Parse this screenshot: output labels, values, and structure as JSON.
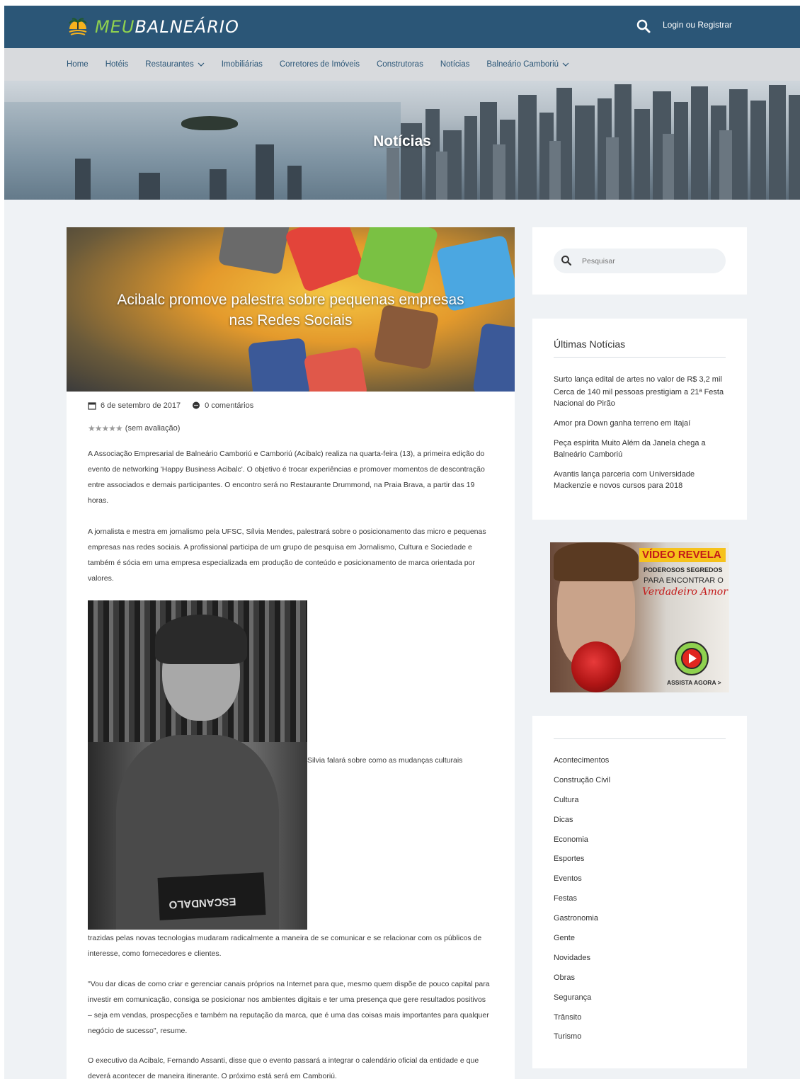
{
  "brand": {
    "logo_part1": "MEU",
    "logo_part2": "BALNEÁRIO"
  },
  "header": {
    "login_label": "Login ou Registrar"
  },
  "nav": {
    "items": [
      {
        "label": "Home",
        "dropdown": false
      },
      {
        "label": "Hotéis",
        "dropdown": false
      },
      {
        "label": "Restaurantes",
        "dropdown": true
      },
      {
        "label": "Imobiliárias",
        "dropdown": false
      },
      {
        "label": "Corretores de Imóveis",
        "dropdown": false
      },
      {
        "label": "Construtoras",
        "dropdown": false
      },
      {
        "label": "Notícias",
        "dropdown": false
      },
      {
        "label": "Balneário Camboriú",
        "dropdown": true
      }
    ]
  },
  "hero": {
    "title": "Notícias"
  },
  "article": {
    "title": "Acibalc promove palestra sobre pequenas empresas nas Redes Sociais",
    "date": "6 de setembro de 2017",
    "comments": "0 comentários",
    "stars": "★★★★★",
    "rating_text": "(sem avaliação)",
    "paragraphs": [
      "A Associação Empresarial de Balneário Camboriú e Camboriú (Acibalc) realiza na quarta-feira (13), a primeira edição do evento de networking 'Happy Business Acibalc'. O objetivo é trocar experiências e promover momentos de descontração entre associados e demais participantes. O encontro será no Restaurante Drummond, na Praia Brava, a partir das 19 horas.",
      "A jornalista e mestra em jornalismo pela UFSC, Sílvia Mendes, palestrará sobre o posicionamento das micro e pequenas empresas nas redes sociais. A profissional participa de um grupo de pesquisa em Jornalismo, Cultura e Sociedade e também é sócia em uma empresa especializada em produção de conteúdo e posicionamento de marca orientada por valores.",
      "trazidas pelas novas tecnologias mudaram radicalmente a maneira de se comunicar e se relacionar com os públicos de interesse, como fornecedores e clientes.",
      "\"Vou dar dicas de como criar e gerenciar canais próprios na Internet para que, mesmo quem dispõe de pouco capital para investir em comunicação, consiga se posicionar nos ambientes digitais e ter uma presença que gere resultados positivos – seja em vendas, prospecções e também na reputação da marca, que é uma das coisas mais importantes para qualquer negócio de sucesso\", resume.",
      "O executivo da Acibalc, Fernando Assanti, disse que o evento passará a integrar o calendário oficial da entidade e que deverá acontecer de maneira itinerante. O próximo está será em Camboriú."
    ],
    "photo_caption": "Silvia falará sobre como as mudanças culturais",
    "book_text": "ESCANDALO"
  },
  "sidebar": {
    "search_placeholder": "Pesquisar",
    "news_title": "Últimas Notícias",
    "news": [
      "Surto lança edital de artes no valor de R$ 3,2 mil",
      "Cerca de 140 mil pessoas prestigiam a 21ª Festa Nacional do Pirão",
      "Amor pra Down ganha terreno em Itajaí",
      "Peça espírita Muito Além da Janela chega a Balneário Camboriú",
      "Avantis lança parceria com Universidade Mackenzie e novos cursos para 2018"
    ],
    "ad": {
      "headline": "VÍDEO REVELA",
      "line2": "PODEROSOS SEGREDOS",
      "line3": "PARA ENCONTRAR O",
      "line4": "Verdadeiro Amor",
      "cta": "ASSISTA AGORA >"
    },
    "categories": [
      "Acontecimentos",
      "Construção Civil",
      "Cultura",
      "Dicas",
      "Economia",
      "Esportes",
      "Eventos",
      "Festas",
      "Gastronomia",
      "Gente",
      "Novidades",
      "Obras",
      "Segurança",
      "Trânsito",
      "Turismo"
    ]
  },
  "colors": {
    "header_bg": "#2b5677",
    "nav_bg": "#d8dadd",
    "page_bg": "#eff2f5",
    "accent_green": "#8fd14f",
    "logo_sun": "#f5b21d"
  },
  "icons": [
    "logo-sun-palm-icon",
    "search-icon",
    "chevron-down-icon",
    "calendar-icon",
    "comment-icon",
    "star-icon",
    "play-icon"
  ]
}
